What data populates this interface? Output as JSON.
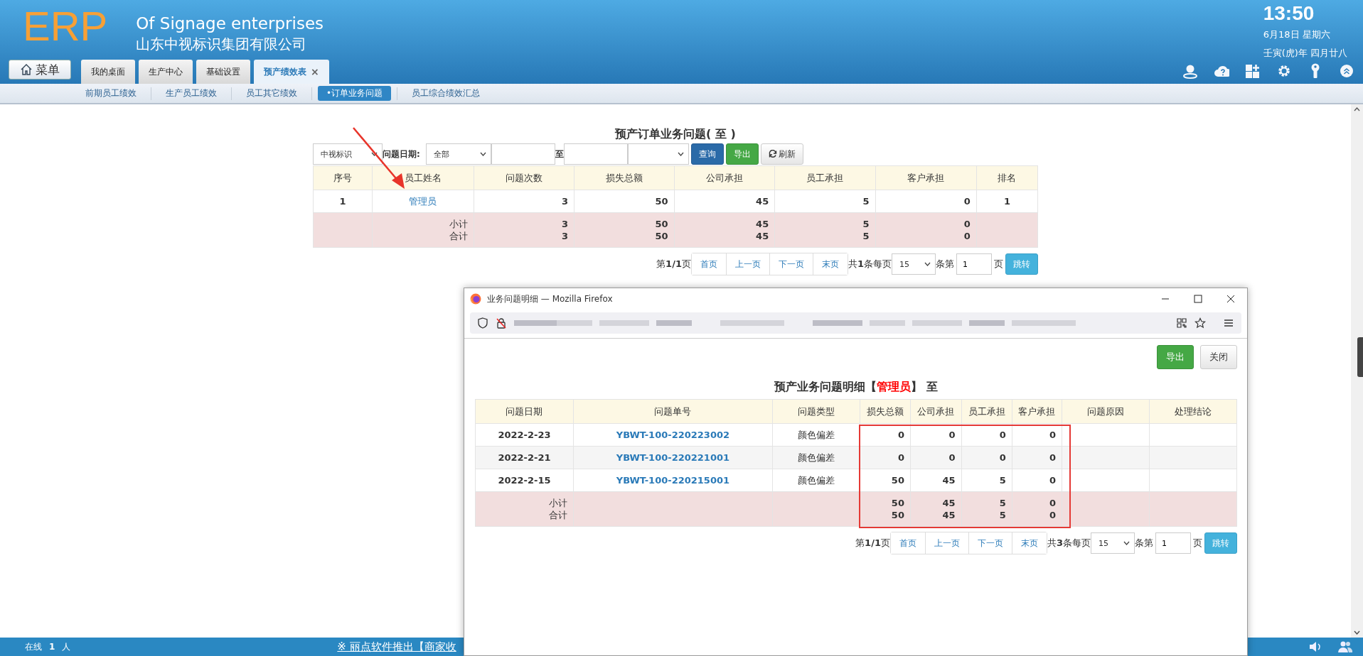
{
  "header": {
    "logo": "ERP",
    "title_en": "Of Signage enterprises",
    "title_cn": "山东中视标识集团有限公司",
    "menu_button": "菜单",
    "tabs": [
      {
        "label": "我的桌面",
        "selected": false
      },
      {
        "label": "生产中心",
        "selected": false
      },
      {
        "label": "基础设置",
        "selected": false
      },
      {
        "label": "预产绩效表",
        "selected": true,
        "close": "×"
      }
    ],
    "clock": {
      "time": "13:50",
      "date": "6月18日 星期六",
      "lunar": "壬寅(虎)年 四月廿八"
    }
  },
  "subnav": [
    {
      "label": "前期员工绩效",
      "selected": false
    },
    {
      "label": "生产员工绩效",
      "selected": false
    },
    {
      "label": "员工其它绩效",
      "selected": false
    },
    {
      "label": "•订单业务问题",
      "selected": true
    },
    {
      "label": "员工综合绩效汇总",
      "selected": false
    }
  ],
  "report": {
    "title": "预产订单业务问题( 至 )",
    "annotation": {
      "kind": "arrow"
    },
    "filters": {
      "company": "中视标识",
      "date_label": "问题日期:",
      "range": "全部",
      "to": "至",
      "buttons": [
        {
          "label": "查询",
          "kind": "primary"
        },
        {
          "label": "导出",
          "kind": "success"
        },
        {
          "label": "刷新",
          "kind": "refresh"
        }
      ]
    },
    "table": {
      "columns": [
        "序号",
        "员工姓名",
        "问题次数",
        "损失总额",
        "公司承担",
        "员工承担",
        "客户承担",
        "排名"
      ],
      "rows": [
        {
          "cells": [
            "1",
            "管理员",
            "3",
            "50",
            "45",
            "5",
            "0",
            "1"
          ]
        }
      ],
      "totals": [
        {
          "label": "小计",
          "values": [
            "3",
            "50",
            "45",
            "5",
            "0"
          ]
        },
        {
          "label": "合计",
          "values": [
            "3",
            "50",
            "45",
            "5",
            "0"
          ]
        }
      ]
    },
    "pagination": {
      "page": "第**1/1**页",
      "buttons": [
        "首页",
        "上一页",
        "下一页",
        "末页"
      ],
      "count": "共**1**条每页",
      "per_page": "15",
      "page_label": "条第",
      "page_input": "1",
      "page_suffix": "页",
      "go": "跳转"
    }
  },
  "popup": {
    "window_title": "业务问题明细 — Mozilla Firefox",
    "buttons": [
      {
        "label": "导出",
        "kind": "success"
      },
      {
        "label": "关闭",
        "kind": "default"
      }
    ],
    "title_prefix": "预产业务问题明细【",
    "title_highlight": "管理员",
    "title_suffix": "】 至",
    "table": {
      "columns": [
        "问题日期",
        "问题单号",
        "问题类型",
        "损失总额",
        "公司承担",
        "员工承担",
        "客户承担",
        "问题原因",
        "处理结论"
      ],
      "rows": [
        {
          "cells": [
            "2022-2-23",
            "YBWT-100-220223002",
            "颜色偏差",
            "0",
            "0",
            "0",
            "0"
          ]
        },
        {
          "cells": [
            "2022-2-21",
            "YBWT-100-220221001",
            "颜色偏差",
            "0",
            "0",
            "0",
            "0"
          ]
        },
        {
          "cells": [
            "2022-2-15",
            "YBWT-100-220215001",
            "颜色偏差",
            "50",
            "45",
            "5",
            "0"
          ]
        }
      ],
      "totals": [
        {
          "label": "小计",
          "values": [
            "50",
            "45",
            "5",
            "0"
          ]
        },
        {
          "label": "合计",
          "values": [
            "50",
            "45",
            "5",
            "0"
          ]
        }
      ],
      "annotation": {
        "kind": "rectangle"
      }
    },
    "pagination": {
      "page": "第**1/1**页",
      "buttons": [
        "首页",
        "上一页",
        "下一页",
        "末页"
      ],
      "count": "共**3**条每页",
      "per_page": "15",
      "page_label": "条第",
      "page_input": "1",
      "page_suffix": "页",
      "go": "跳转"
    }
  },
  "status_bar": {
    "online_label": "在线",
    "online_count": "1",
    "online_unit": "人",
    "marquee": "※ 丽点软件推出【商家收"
  }
}
